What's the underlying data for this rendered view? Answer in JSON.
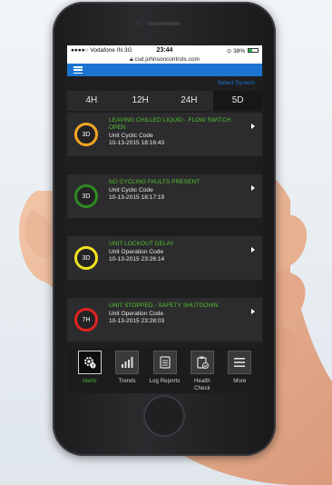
{
  "status_bar": {
    "carrier": "●●●●○ Vodafone IN  3G",
    "time": "23:44",
    "battery_text": "38%"
  },
  "url": "csd.johnsoncontrols.com",
  "select_system_label": "Select System",
  "tabs": [
    {
      "label": "4H"
    },
    {
      "label": "12H"
    },
    {
      "label": "24H"
    },
    {
      "label": "5D"
    }
  ],
  "active_tab": 3,
  "alerts": [
    {
      "badge": "3D",
      "ring_color": "#f5a623",
      "title": "LEAVING CHILLED LIQUID - FLOW SWITCH OPEN",
      "code": "Unit Cyclic Code",
      "timestamp": "10-13-2015 18:16:43"
    },
    {
      "badge": "3D",
      "ring_color": "#2e8b22",
      "title": "NO CYCLING FAULTS PRESENT",
      "code": "Unit Cyclic Code",
      "timestamp": "10-13-2015 18:17:19"
    },
    {
      "badge": "3D",
      "ring_color": "#f2e21c",
      "title": "UNIT LOCKOUT DELAY",
      "code": "Unit Operation Code",
      "timestamp": "10-13-2015 23:26:14"
    },
    {
      "badge": "7H",
      "ring_color": "#e2221f",
      "title": "UNIT STOPPED - SAFETY SHUTDOWN",
      "code": "Unit Operation Code",
      "timestamp": "10-13-2015 23:28:03"
    }
  ],
  "nav": [
    {
      "label": "Alerts",
      "icon": "gear-alert-icon"
    },
    {
      "label": "Trends",
      "icon": "bar-chart-icon"
    },
    {
      "label": "Log Reports",
      "icon": "log-icon"
    },
    {
      "label": "Health Check",
      "icon": "clipboard-check-icon"
    },
    {
      "label": "More",
      "icon": "menu-icon"
    }
  ],
  "colors": {
    "accent_blue": "#1b75d0",
    "alert_title_green": "#55c12e"
  }
}
